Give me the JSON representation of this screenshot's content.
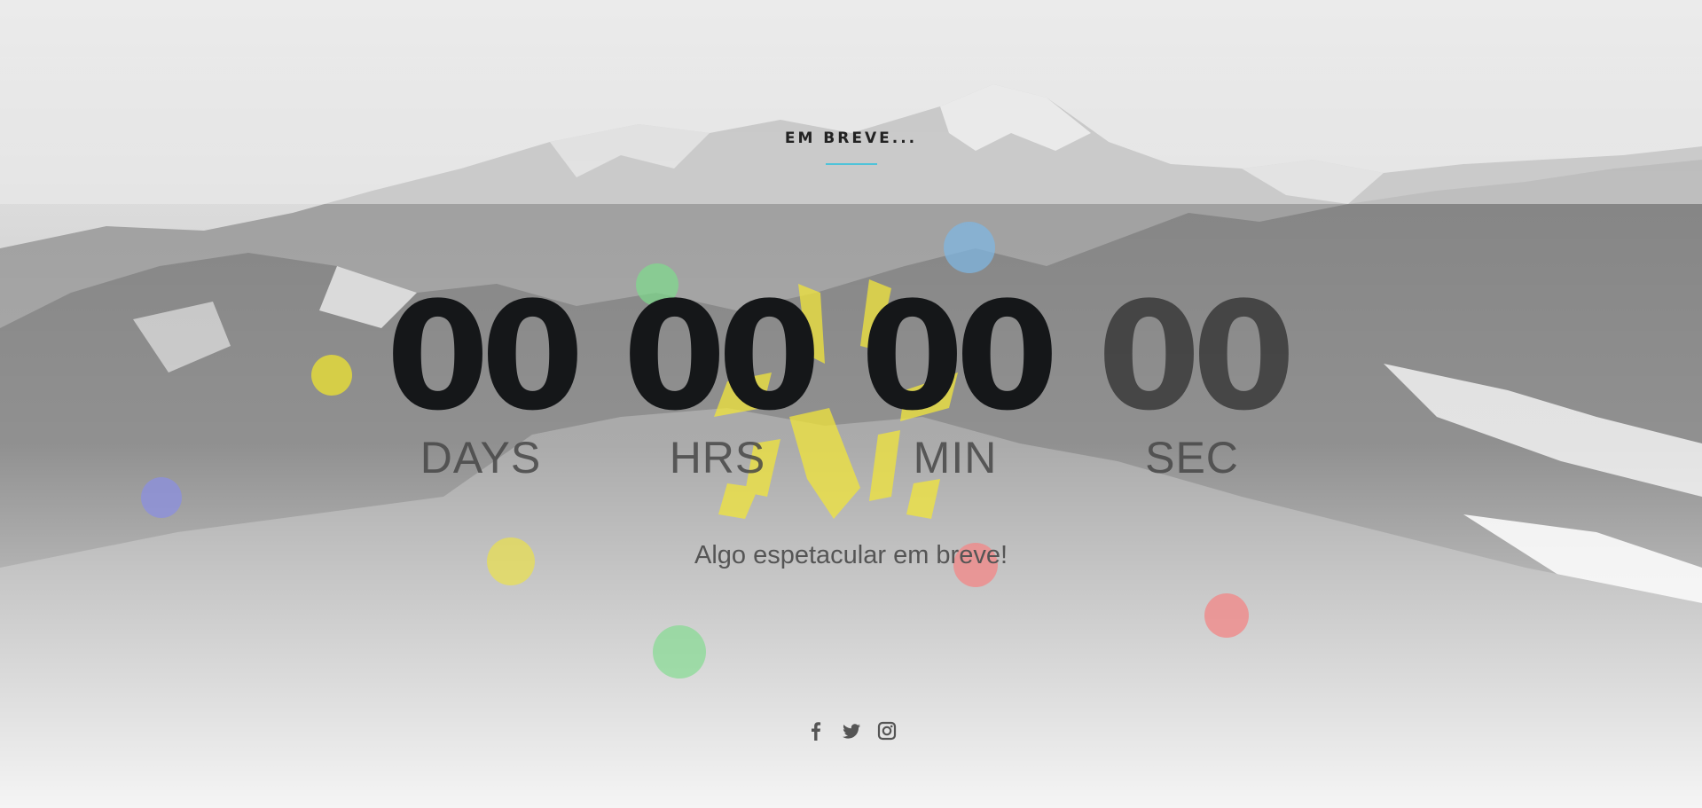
{
  "hero": {
    "eyebrow": "EM BREVE...",
    "tagline": "Algo espetacular em breve!"
  },
  "countdown": [
    {
      "value": "00",
      "label": "DAYS"
    },
    {
      "value": "00",
      "label": "HRS"
    },
    {
      "value": "00",
      "label": "MIN"
    },
    {
      "value": "00",
      "label": "SEC"
    }
  ],
  "social": {
    "icons": [
      "facebook-icon",
      "twitter-icon",
      "instagram-icon"
    ]
  },
  "colors": {
    "accent": "#4fc3d9",
    "digits": "#151719",
    "bubble_yellow": "#f5ea2a",
    "bubble_green": "#7edb8c",
    "bubble_blue": "#7fb6e0",
    "bubble_purple": "#8b8fe0",
    "bubble_red": "#f08a8a"
  }
}
